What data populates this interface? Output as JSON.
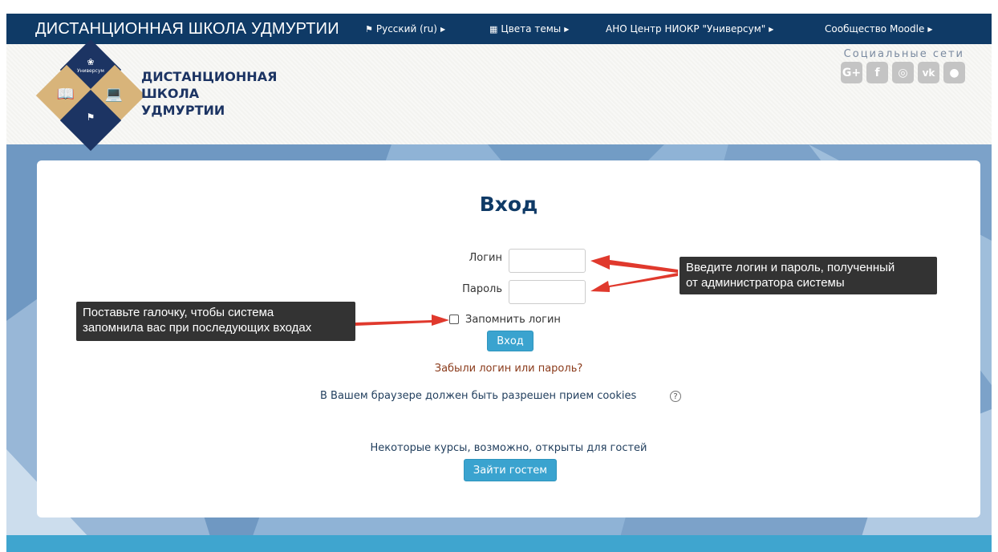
{
  "navbar": {
    "brand": "ДИСТАНЦИОННАЯ ШКОЛА УДМУРТИИ",
    "items": [
      {
        "label": "Русский (ru)",
        "icon": "flag-icon"
      },
      {
        "label": "Цвета темы",
        "icon": "grid-icon"
      },
      {
        "label": "АНО Центр НИОКР \"Универсум\""
      },
      {
        "label": "Сообщество Moodle"
      }
    ]
  },
  "header": {
    "logo_lines": [
      "ДИСТАНЦИОННАЯ",
      "ШКОЛА",
      "УДМУРТИИ"
    ],
    "logo_badge": "Универсум",
    "social_title": "Социальные сети",
    "social": [
      {
        "icon": "google-plus-icon",
        "glyph": "G+"
      },
      {
        "icon": "facebook-icon",
        "glyph": "f"
      },
      {
        "icon": "instagram-icon",
        "glyph": "◎"
      },
      {
        "icon": "vk-icon",
        "glyph": "vk"
      },
      {
        "icon": "globe-icon",
        "glyph": "●"
      }
    ]
  },
  "login": {
    "title": "Вход",
    "username_label": "Логин",
    "username_value": "",
    "password_label": "Пароль",
    "password_value": "",
    "remember_label": "Запомнить логин",
    "remember_checked": false,
    "submit_label": "Вход",
    "forgot_link": "Забыли логин или пароль?",
    "cookies_notice": "В Вашем браузере должен быть разрешен прием cookies",
    "guest_notice": "Некоторые курсы, возможно, открыты для гостей",
    "guest_button": "Зайти гостем"
  },
  "annotations": {
    "credentials_note": [
      "Введите логин и пароль, полученный",
      "от администратора системы"
    ],
    "remember_note": [
      "Поставьте галочку, чтобы система",
      "запомнила вас при последующих входах"
    ]
  },
  "colors": {
    "navbar": "#0f3a66",
    "accent_button": "#3aa3cf",
    "title": "#0f3a66",
    "link": "#8a3a1a",
    "arrow": "#e0392d",
    "logo_navy": "#1c3463",
    "logo_gold": "#d8b47a"
  }
}
